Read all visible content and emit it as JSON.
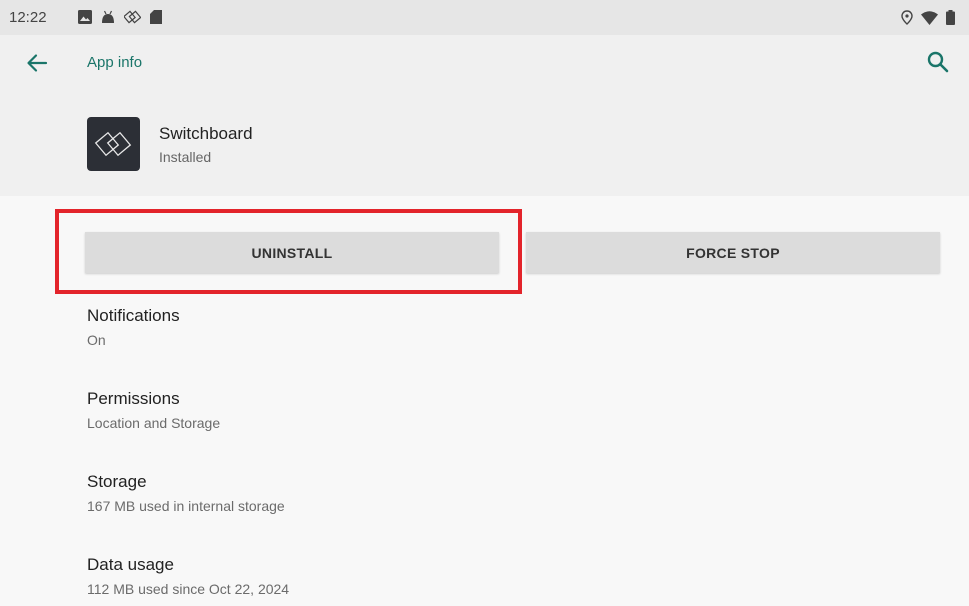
{
  "status_bar": {
    "time": "12:22",
    "left_icons": [
      "image-icon",
      "android-icon",
      "switchboard-notification-icon",
      "sd-card-icon"
    ],
    "right_icons": [
      "location-icon",
      "wifi-icon",
      "battery-icon"
    ]
  },
  "app_bar": {
    "title": "App info",
    "back_icon": "arrow-back-icon",
    "search_icon": "search-icon",
    "accent_color": "#1a7569"
  },
  "app": {
    "name": "Switchboard",
    "status": "Installed",
    "icon": "switchboard-app-icon"
  },
  "actions": {
    "uninstall_label": "UNINSTALL",
    "force_stop_label": "FORCE STOP"
  },
  "highlight": {
    "target": "uninstall-button",
    "color": "#e3242b"
  },
  "preferences": [
    {
      "title": "Notifications",
      "summary": "On"
    },
    {
      "title": "Permissions",
      "summary": "Location and Storage"
    },
    {
      "title": "Storage",
      "summary": "167 MB used in internal storage"
    },
    {
      "title": "Data usage",
      "summary": "112 MB used since Oct 22, 2024"
    }
  ]
}
